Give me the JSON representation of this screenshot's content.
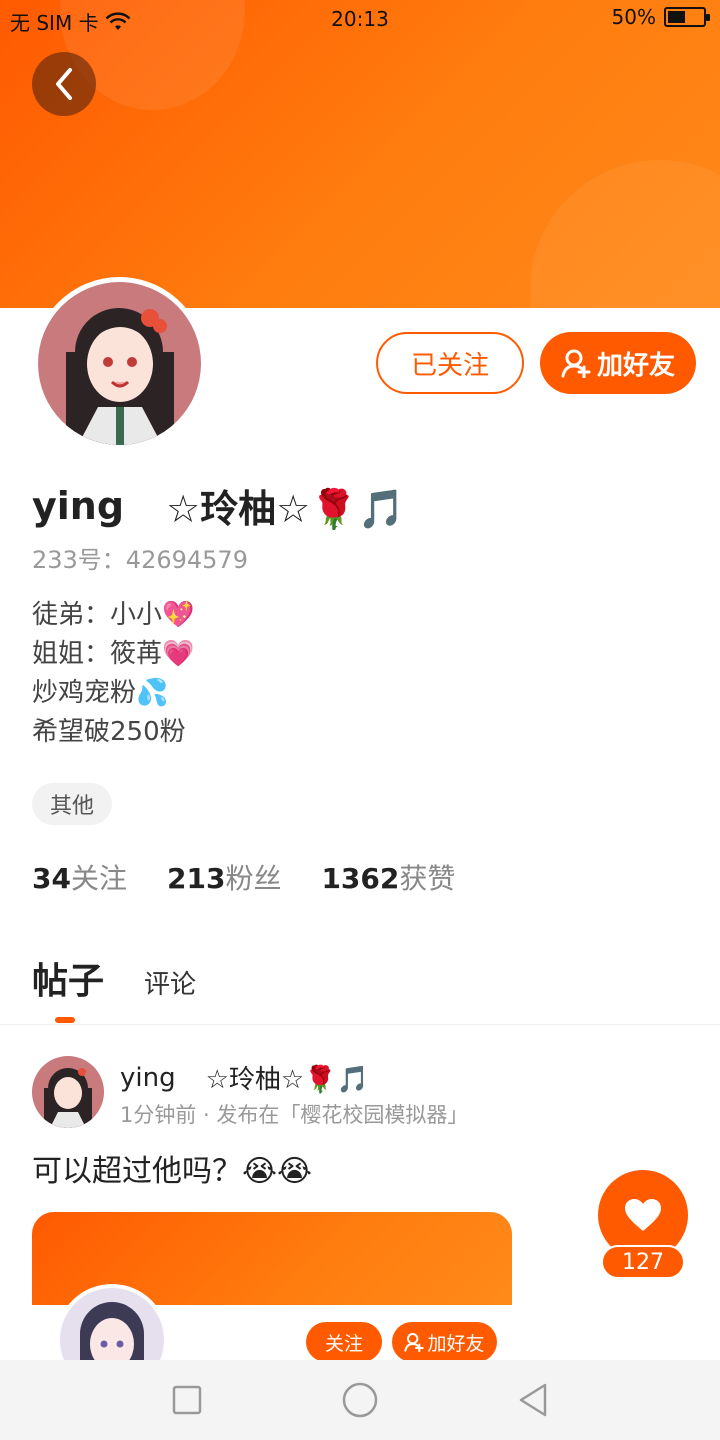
{
  "status_bar": {
    "carrier": "无 SIM 卡",
    "time": "20:13",
    "battery_text": "50%",
    "battery_level": 0.5
  },
  "profile": {
    "name": "ying",
    "nickname": "☆玲柚☆🌹🎵",
    "uid": "233号：42694579",
    "bio": [
      "徒弟：小小💖",
      "姐姐：筱苒💗",
      "炒鸡宠粉💦",
      "希望破250粉"
    ],
    "tag": "其他",
    "stats": [
      {
        "num": "34",
        "label": "关注"
      },
      {
        "num": "213",
        "label": "粉丝"
      },
      {
        "num": "1362",
        "label": "获赞"
      }
    ]
  },
  "actions": {
    "followed_label": "已关注",
    "add_friend_label": "加好友"
  },
  "tabs": {
    "posts": "帖子",
    "comments": "评论"
  },
  "post": {
    "author": "ying",
    "author_suffix": "☆玲柚☆🌹🎵",
    "meta": "1分钟前 · 发布在「樱花校园模拟器」",
    "text": "可以超过他吗？😭😭",
    "card": {
      "follow_label": "关注",
      "add_friend_label": "加好友"
    }
  },
  "like": {
    "count": "127"
  },
  "colors": {
    "accent": "#ff5a00"
  },
  "icons": {
    "back": "chevron-left-icon",
    "add_friend": "add-user-icon",
    "like": "heart-icon"
  }
}
